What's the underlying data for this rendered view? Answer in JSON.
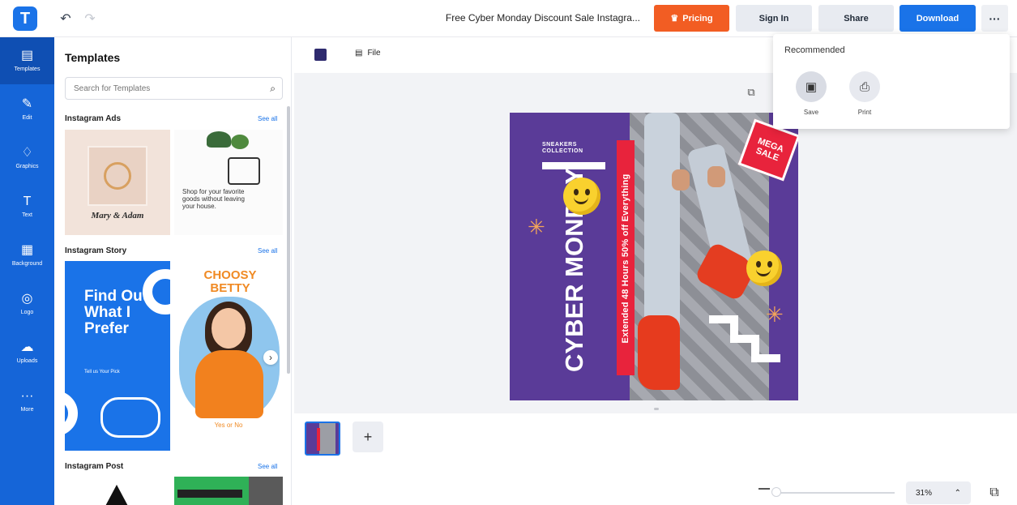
{
  "header": {
    "logo_letter": "T",
    "undo_icon": "undo-icon",
    "redo_icon": "redo-icon",
    "doc_title": "Free Cyber Monday Discount Sale Instagra...",
    "pricing_label": "Pricing",
    "signin_label": "Sign In",
    "share_label": "Share",
    "download_label": "Download",
    "more_label": "···",
    "colors": {
      "pricing": "#f25d23",
      "download": "#1a73e8",
      "rail": "#1565d8"
    }
  },
  "rail": {
    "items": [
      {
        "label": "Templates",
        "icon": "templates-icon",
        "glyph": "▤"
      },
      {
        "label": "Edit",
        "icon": "edit-icon",
        "glyph": "✎"
      },
      {
        "label": "Graphics",
        "icon": "graphics-icon",
        "glyph": "♢"
      },
      {
        "label": "Text",
        "icon": "text-icon",
        "glyph": "T"
      },
      {
        "label": "Background",
        "icon": "background-icon",
        "glyph": "▦"
      },
      {
        "label": "Logo",
        "icon": "logo-icon",
        "glyph": "◎"
      },
      {
        "label": "Uploads",
        "icon": "uploads-icon",
        "glyph": "☁"
      },
      {
        "label": "More",
        "icon": "more-icon",
        "glyph": "···"
      }
    ]
  },
  "panel": {
    "title": "Templates",
    "search_placeholder": "Search for Templates",
    "sections": [
      {
        "title": "Instagram Ads",
        "see_all": "See all"
      },
      {
        "title": "Instagram Story",
        "see_all": "See all"
      },
      {
        "title": "Instagram Post",
        "see_all": "See all"
      }
    ],
    "thumbs": {
      "ads1_name": "Mary & Adam",
      "ads2_text": "Shop for your favorite goods without leaving your house.",
      "story1_big": "Find Out What I Prefer",
      "story1_small": "Tell us Your Pick",
      "story2_head": "CHOOSY BETTY",
      "story2_foot": "Yes or No"
    }
  },
  "editor": {
    "file_label": "File",
    "copy_icon": "duplicate-icon"
  },
  "design": {
    "sneakers_text": "SNEAKERS COLLECTION",
    "cyber_text": "CYBER MONDAY",
    "band_text": "Extended 48 Hours 50% off Everything",
    "mega_text": "MEGA SALE"
  },
  "pages": {
    "add_label": "+"
  },
  "zoom": {
    "value": "31%",
    "caret": "⌃"
  },
  "dropdown": {
    "title": "Recommended",
    "items": [
      {
        "label": "Save",
        "icon": "save-icon",
        "glyph": "▣"
      },
      {
        "label": "Print",
        "icon": "print-icon",
        "glyph": "⎙"
      }
    ]
  }
}
